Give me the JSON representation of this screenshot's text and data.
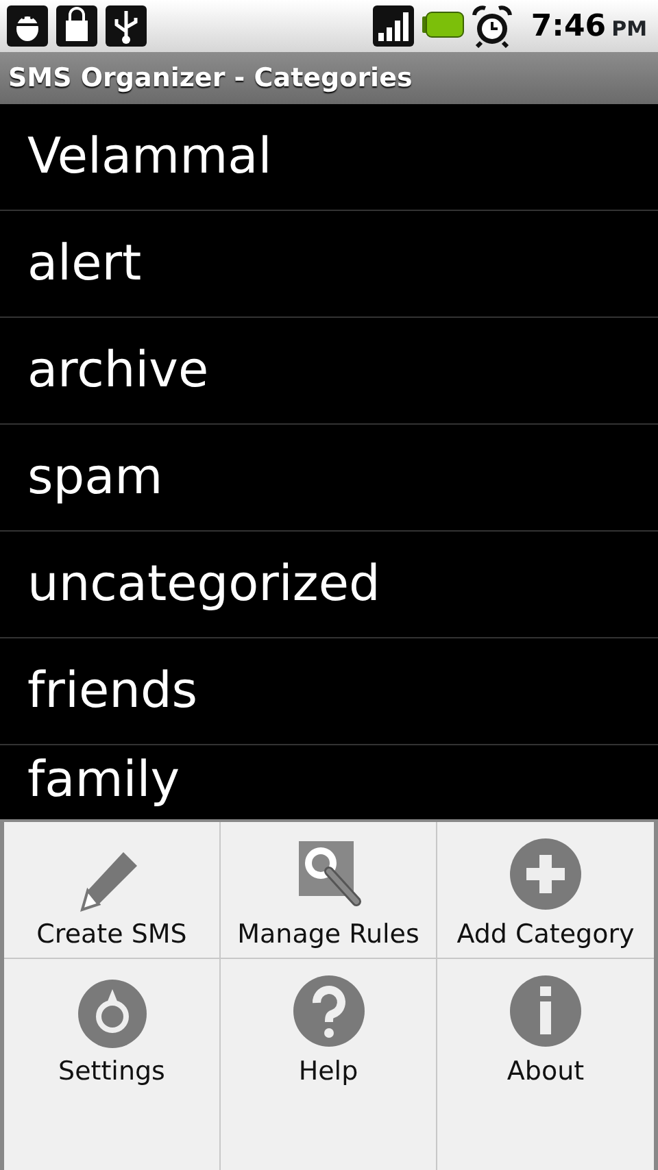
{
  "status_bar": {
    "time": "7:46",
    "ampm": "PM"
  },
  "title_bar": {
    "title": "SMS Organizer - Categories"
  },
  "categories": [
    {
      "label": "Velammal"
    },
    {
      "label": "alert"
    },
    {
      "label": "archive"
    },
    {
      "label": "spam"
    },
    {
      "label": "uncategorized"
    },
    {
      "label": "friends"
    },
    {
      "label": "family"
    }
  ],
  "menu": [
    {
      "label": "Create SMS"
    },
    {
      "label": "Manage Rules"
    },
    {
      "label": "Add Category"
    },
    {
      "label": "Settings"
    },
    {
      "label": "Help"
    },
    {
      "label": "About"
    }
  ]
}
